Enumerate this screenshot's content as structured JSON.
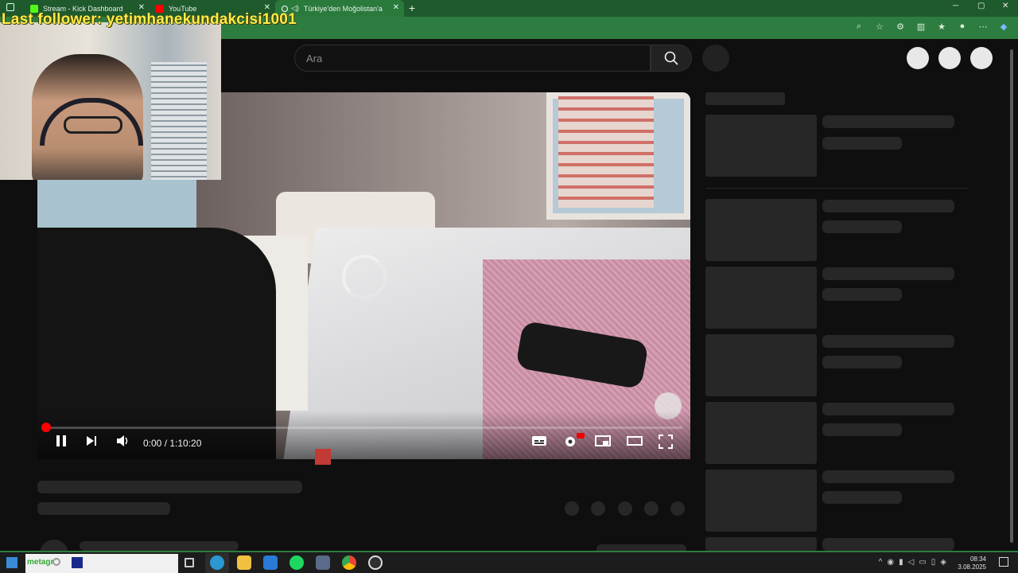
{
  "browser": {
    "tabs": [
      {
        "title": "Stream - Kick Dashboard",
        "favicon_color": "#53fc18"
      },
      {
        "title": "YouTube",
        "favicon_color": "#ff0000"
      },
      {
        "title": "Türkiye'den Moğolistan'a Yü",
        "favicon_color": "#ffffff"
      }
    ],
    "new_tab": "+",
    "window_controls": {
      "minimize": "─",
      "maximize": "▢",
      "close": "✕"
    },
    "tab_close": "✕",
    "accent": "#2e7d40"
  },
  "overlay": {
    "last_follower": "Last follower: yetimhanekundakcisi1001",
    "color": "#ffec4a"
  },
  "youtube": {
    "search_placeholder": "Ara",
    "player": {
      "time": "0:00 / 1:10:20",
      "progress": 0.0,
      "status": "loading"
    }
  },
  "taskbar": {
    "search_text": "metagr",
    "clock_time": "08:34",
    "clock_date": "3.08.2025",
    "apps": [
      "task-view",
      "edge",
      "file-explorer",
      "store",
      "spotify",
      "calculator",
      "chrome",
      "obs"
    ]
  }
}
